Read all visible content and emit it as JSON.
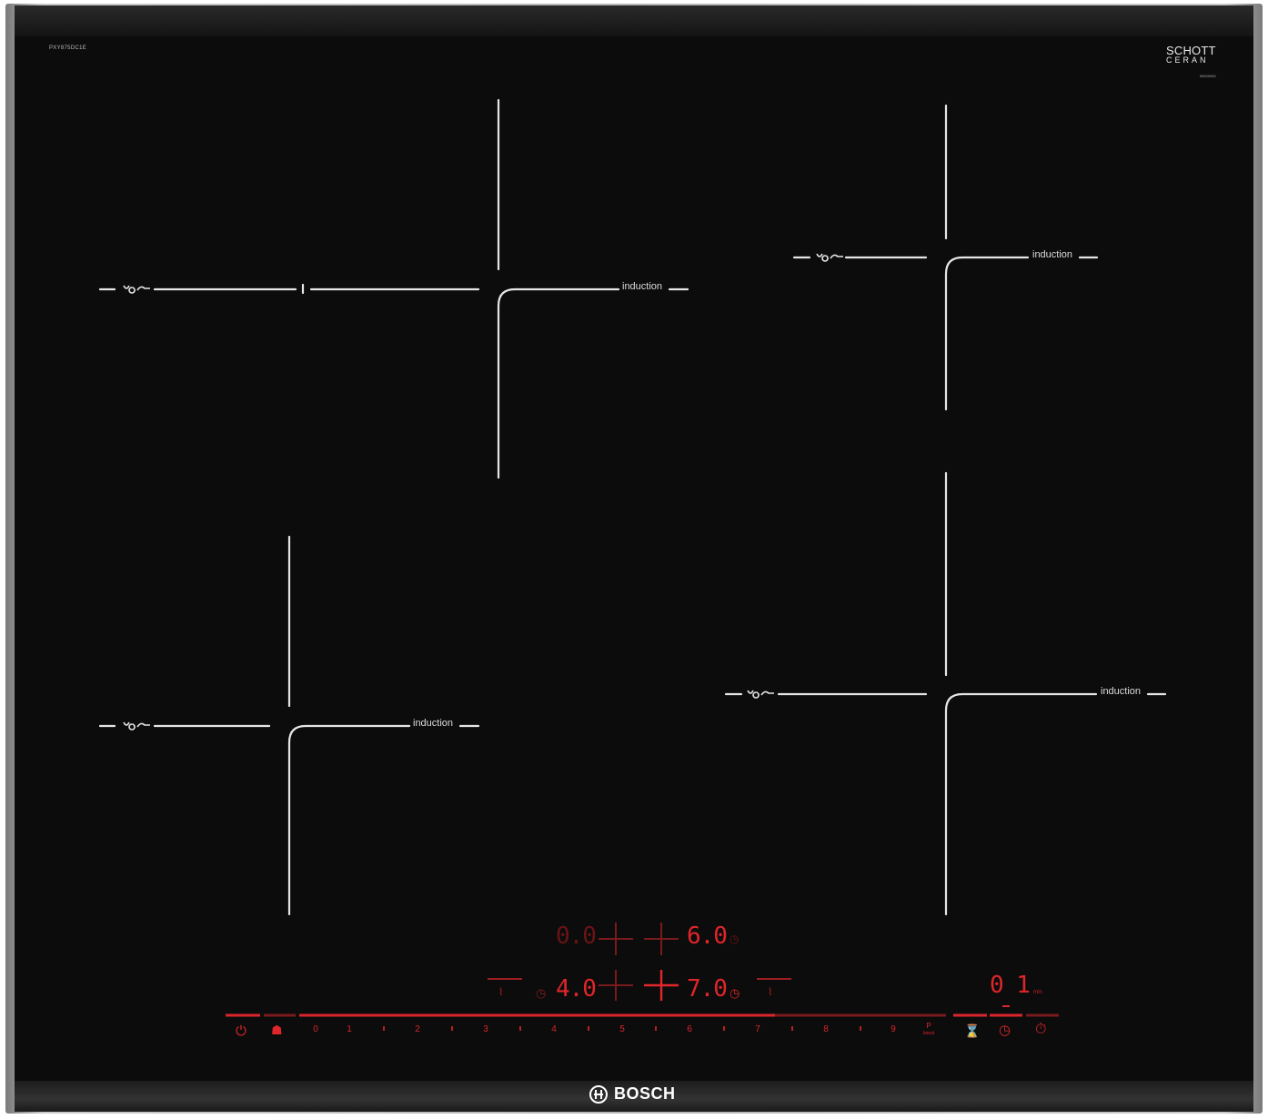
{
  "model_code": "PXY875DC1E",
  "glass_brand": {
    "line1": "SCHOTT",
    "line2": "CERAN",
    "line3": "90000000"
  },
  "zones": [
    {
      "id": "front-left",
      "label": "induction"
    },
    {
      "id": "rear-left",
      "label": "induction"
    },
    {
      "id": "front-right",
      "label": "induction"
    },
    {
      "id": "rear-right",
      "label": "induction"
    }
  ],
  "displays": {
    "top_left": "0.0",
    "top_right": "6.0",
    "bottom_left": "4.0",
    "bottom_right": "7.0",
    "timer": "0 1",
    "timer_unit": "min"
  },
  "slider": {
    "levels": [
      "0",
      "1",
      "2",
      "3",
      "4",
      "5",
      "6",
      "7",
      "8",
      "9"
    ],
    "boost_label": "P",
    "boost_sub": "boost"
  },
  "icons": {
    "power": "power-icon",
    "child_lock": "child-lock-icon",
    "boost": "boost-icon",
    "hourglass": "hourglass-icon",
    "timer": "timer-icon",
    "stopwatch": "stopwatch-icon",
    "flex": "flex-zone-icon"
  },
  "brand": "BOSCH",
  "colors": {
    "glass": "#0c0c0c",
    "display": "#e0252a",
    "print": "#dcdcdc"
  }
}
